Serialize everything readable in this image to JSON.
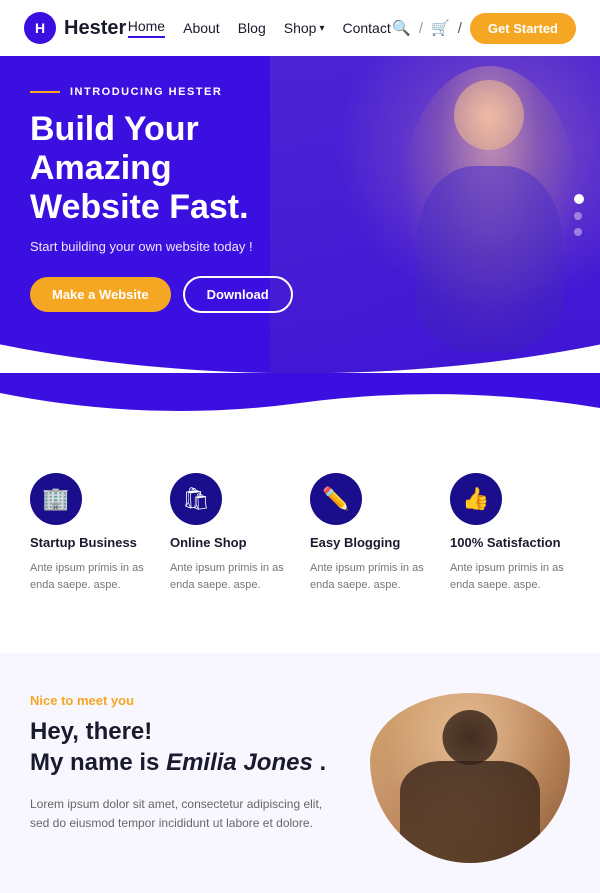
{
  "brand": {
    "logo_letter": "H",
    "name": "Hester"
  },
  "nav": {
    "items": [
      {
        "label": "Home",
        "active": true
      },
      {
        "label": "About",
        "active": false
      },
      {
        "label": "Blog",
        "active": false
      },
      {
        "label": "Shop",
        "active": false,
        "has_dropdown": true
      },
      {
        "label": "Contact",
        "active": false
      }
    ],
    "cta_label": "Get Started"
  },
  "hero": {
    "eyebrow": "INTRODUCING HESTER",
    "title_line1": "Build Your Amazing",
    "title_line2": "Website Fast.",
    "subtitle": "Start building your own website today !",
    "btn_primary": "Make a Website",
    "btn_outline": "Download"
  },
  "features": [
    {
      "icon": "🏢",
      "title": "Startup Business",
      "desc": "Ante ipsum primis in as enda saepe. aspe."
    },
    {
      "icon": "🛍",
      "title": "Online Shop",
      "desc": "Ante ipsum primis in as enda saepe. aspe."
    },
    {
      "icon": "✏️",
      "title": "Easy Blogging",
      "desc": "Ante ipsum primis in as enda saepe. aspe."
    },
    {
      "icon": "👍",
      "title": "100% Satisfaction",
      "desc": "Ante ipsum primis in as enda saepe. aspe."
    }
  ],
  "intro": {
    "eyebrow": "Nice to meet you",
    "title_plain": "Hey, there!",
    "title_italic": "Emilia Jones",
    "title_suffix": "My name is",
    "title_end": ".",
    "desc": "Lorem ipsum dolor sit amet, consectetur adipiscing elit, sed do eiusmod tempor incididunt ut labore et dolore."
  }
}
